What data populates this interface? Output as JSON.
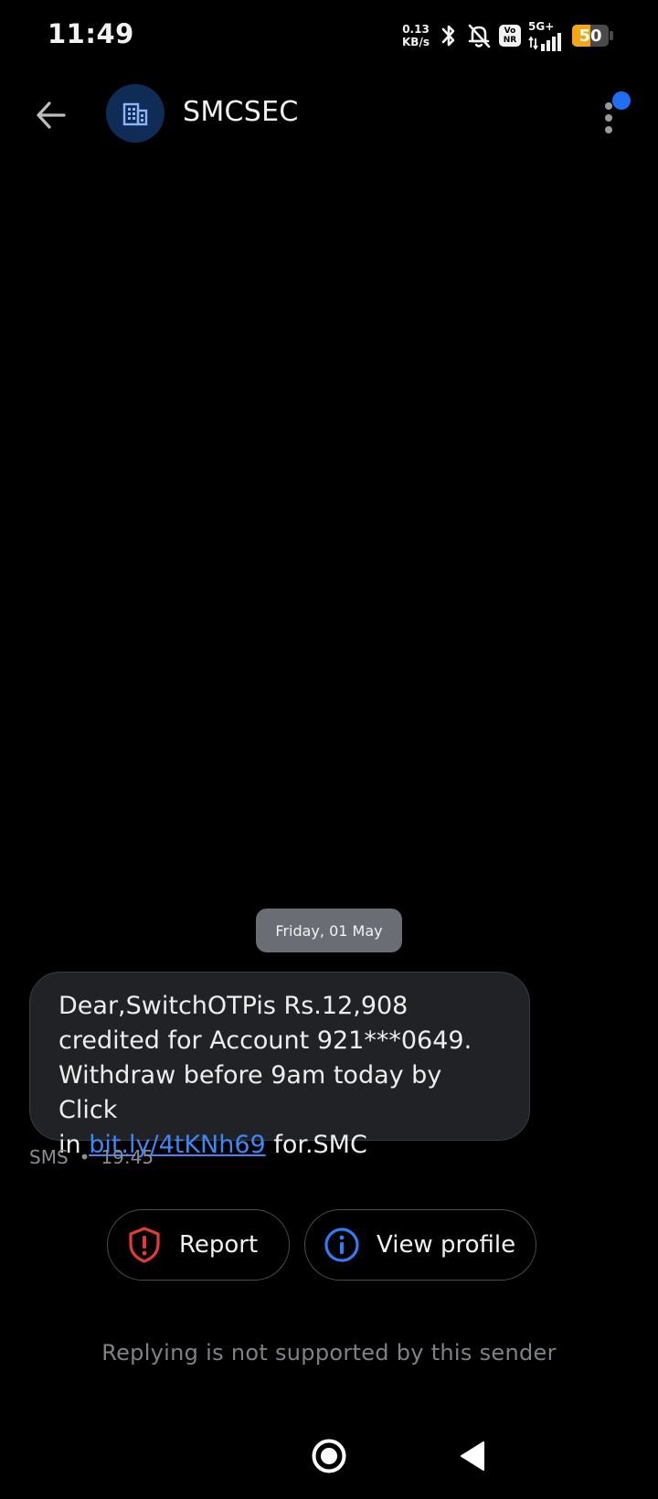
{
  "status_bar": {
    "time": "11:49",
    "net_speed_value": "0.13",
    "net_speed_unit": "KB/s",
    "vonr_top": "Vo",
    "vonr_bottom": "NR",
    "network_type": "5G+",
    "battery_level": "50",
    "battery_fraction": 0.5,
    "battery_color": "#f3a712"
  },
  "header": {
    "back_icon": "arrow-left-icon",
    "avatar_icon": "building-icon",
    "sender_name": "SMCSEC",
    "more_icon": "more-vert-icon",
    "notification_color": "#1f6ff2"
  },
  "conversation": {
    "date_label": "Friday, 01 May",
    "message": {
      "line1": "Dear,SwitchOTPis Rs.12,908",
      "line2": "credited for Account 921***0649.",
      "line3": "Withdraw before 9am today by Click",
      "line4_prefix": "in ",
      "link_text": "bit.ly/4tKNh69",
      "line4_suffix": " for.SMC"
    },
    "meta": {
      "type": "SMS",
      "separator": "•",
      "time": "19:45"
    }
  },
  "actions": {
    "report_label": "Report",
    "report_icon": "shield-alert-icon",
    "report_color": "#e53935",
    "profile_label": "View profile",
    "profile_icon": "info-icon",
    "profile_color": "#2f7cf6"
  },
  "footer": {
    "reply_note": "Replying is not supported by this sender"
  },
  "nav": {
    "home_icon": "home-circle-icon",
    "back_icon": "back-triangle-icon"
  }
}
